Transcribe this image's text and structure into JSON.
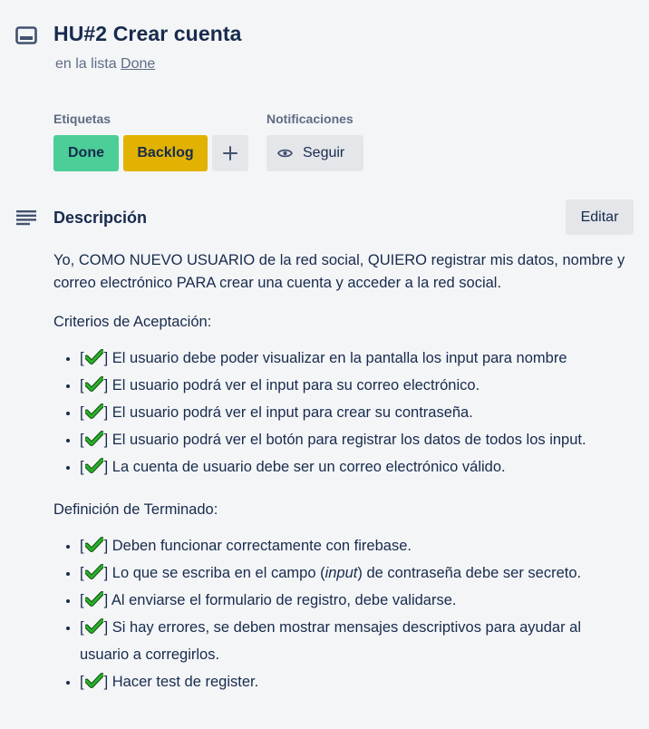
{
  "card": {
    "title": "HU#2 Crear cuenta",
    "in_list_prefix": "en la lista",
    "list_name": "Done"
  },
  "labels": {
    "heading": "Etiquetas",
    "items": [
      {
        "text": "Done",
        "color": "#4bce97"
      },
      {
        "text": "Backlog",
        "color": "#e2b203"
      }
    ],
    "add_symbol": "+"
  },
  "notifications": {
    "heading": "Notificaciones",
    "follow_label": "Seguir"
  },
  "description": {
    "heading": "Descripción",
    "edit_label": "Editar",
    "intro": "Yo, COMO NUEVO USUARIO de la red social, QUIERO registrar mis datos, nombre y correo electrónico PARA crear una cuenta y acceder a la red social.",
    "criteria_title": "Criterios de Aceptación:",
    "criteria": [
      "El usuario debe poder visualizar en la pantalla los input para nombre",
      "El usuario podrá ver el input para su correo electrónico.",
      "El usuario podrá ver el input para crear su contraseña.",
      "El usuario podrá ver el botón para registrar los datos de todos los input.",
      "La cuenta de usuario debe ser un correo electrónico válido."
    ],
    "done_title": "Definición de Terminado:",
    "done_items": [
      {
        "before": "Deben funcionar correctamente con firebase.",
        "italic": "",
        "after": ""
      },
      {
        "before": "Lo que se escriba en el campo (",
        "italic": "input",
        "after": ") de contraseña debe ser secreto."
      },
      {
        "before": "Al enviarse el formulario de registro, debe validarse.",
        "italic": "",
        "after": ""
      },
      {
        "before": "Si hay errores, se deben mostrar mensajes descriptivos para ayudar al usuario a corregirlos.",
        "italic": "",
        "after": ""
      },
      {
        "before": "Hacer test de register.",
        "italic": "",
        "after": ""
      }
    ]
  },
  "icons": {
    "card": "card-icon",
    "description": "description-icon",
    "follow": "eye-icon",
    "check": "check-icon",
    "check_color": "#2bb02b"
  }
}
